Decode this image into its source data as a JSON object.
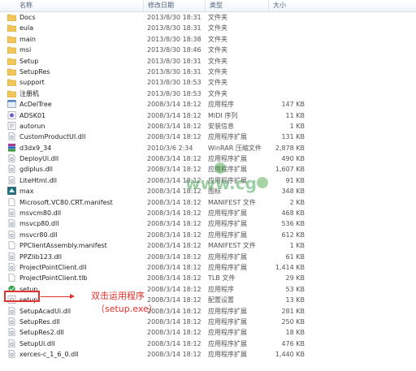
{
  "columns": {
    "name": "名称",
    "date": "修改日期",
    "type": "类型",
    "size": "大小"
  },
  "files": [
    {
      "name": "Docs",
      "date": "2013/8/30 18:31",
      "type": "文件夹",
      "size": "",
      "icon": "folder-icon"
    },
    {
      "name": "eula",
      "date": "2013/8/30 18:31",
      "type": "文件夹",
      "size": "",
      "icon": "folder-icon"
    },
    {
      "name": "main",
      "date": "2013/8/30 18:38",
      "type": "文件夹",
      "size": "",
      "icon": "folder-icon"
    },
    {
      "name": "msi",
      "date": "2013/8/30 18:46",
      "type": "文件夹",
      "size": "",
      "icon": "folder-icon"
    },
    {
      "name": "Setup",
      "date": "2013/8/30 18:31",
      "type": "文件夹",
      "size": "",
      "icon": "folder-icon"
    },
    {
      "name": "SetupRes",
      "date": "2013/8/30 18:31",
      "type": "文件夹",
      "size": "",
      "icon": "folder-icon"
    },
    {
      "name": "support",
      "date": "2013/8/30 18:53",
      "type": "文件夹",
      "size": "",
      "icon": "folder-icon"
    },
    {
      "name": "注册机",
      "date": "2013/8/30 18:53",
      "type": "文件夹",
      "size": "",
      "icon": "folder-icon"
    },
    {
      "name": "AcDelTree",
      "date": "2008/3/14 18:12",
      "type": "应用程序",
      "size": "147 KB",
      "icon": "application-icon"
    },
    {
      "name": "ADSK01",
      "date": "2008/3/14 18:12",
      "type": "MIDI 序列",
      "size": "11 KB",
      "icon": "midi-file-icon"
    },
    {
      "name": "autorun",
      "date": "2008/3/14 18:12",
      "type": "安装信息",
      "size": "1 KB",
      "icon": "setup-info-icon"
    },
    {
      "name": "CustomProductUI.dll",
      "date": "2008/3/14 18:12",
      "type": "应用程序扩展",
      "size": "131 KB",
      "icon": "dll-icon"
    },
    {
      "name": "d3dx9_34",
      "date": "2010/3/6 2:34",
      "type": "WinRAR 压缩文件",
      "size": "2,878 KB",
      "icon": "winrar-archive-icon"
    },
    {
      "name": "DeployUi.dll",
      "date": "2008/3/14 18:12",
      "type": "应用程序扩展",
      "size": "490 KB",
      "icon": "dll-icon"
    },
    {
      "name": "gdiplus.dll",
      "date": "2008/3/14 18:12",
      "type": "应用程序扩展",
      "size": "1,607 KB",
      "icon": "dll-icon"
    },
    {
      "name": "LiteHtml.dll",
      "date": "2008/3/14 18:12",
      "type": "应用程序扩展",
      "size": "91 KB",
      "icon": "dll-icon"
    },
    {
      "name": "max",
      "date": "2008/3/14 18:12",
      "type": "图标",
      "size": "348 KB",
      "icon": "max-icon"
    },
    {
      "name": "Microsoft.VC80.CRT.manifest",
      "date": "2008/3/14 18:12",
      "type": "MANIFEST 文件",
      "size": "2 KB",
      "icon": "manifest-file-icon"
    },
    {
      "name": "msvcm80.dll",
      "date": "2008/3/14 18:12",
      "type": "应用程序扩展",
      "size": "468 KB",
      "icon": "dll-icon"
    },
    {
      "name": "msvcp80.dll",
      "date": "2008/3/14 18:12",
      "type": "应用程序扩展",
      "size": "536 KB",
      "icon": "dll-icon"
    },
    {
      "name": "msvcr80.dll",
      "date": "2008/3/14 18:12",
      "type": "应用程序扩展",
      "size": "612 KB",
      "icon": "dll-icon"
    },
    {
      "name": "PPClientAssembly.manifest",
      "date": "2008/3/14 18:12",
      "type": "MANIFEST 文件",
      "size": "1 KB",
      "icon": "manifest-file-icon"
    },
    {
      "name": "PPZlib123.dll",
      "date": "2008/3/14 18:12",
      "type": "应用程序扩展",
      "size": "61 KB",
      "icon": "dll-icon"
    },
    {
      "name": "ProjectPointClient.dll",
      "date": "2008/3/14 18:12",
      "type": "应用程序扩展",
      "size": "1,414 KB",
      "icon": "dll-icon"
    },
    {
      "name": "ProjectPointClient.tlb",
      "date": "2008/3/14 18:12",
      "type": "TLB 文件",
      "size": "29 KB",
      "icon": "tlb-file-icon"
    },
    {
      "name": "setup",
      "date": "2008/3/14 18:12",
      "type": "应用程序",
      "size": "53 KB",
      "icon": "setup-exe-icon"
    },
    {
      "name": "setup",
      "date": "2008/3/14 18:12",
      "type": "配置设置",
      "size": "13 KB",
      "icon": "config-settings-icon"
    },
    {
      "name": "SetupAcadUi.dll",
      "date": "2008/3/14 18:12",
      "type": "应用程序扩展",
      "size": "281 KB",
      "icon": "dll-icon"
    },
    {
      "name": "SetupRes.dll",
      "date": "2008/3/14 18:12",
      "type": "应用程序扩展",
      "size": "250 KB",
      "icon": "dll-icon"
    },
    {
      "name": "SetupRes2.dll",
      "date": "2008/3/14 18:12",
      "type": "应用程序扩展",
      "size": "18 KB",
      "icon": "dll-icon"
    },
    {
      "name": "SetupUi.dll",
      "date": "2008/3/14 18:12",
      "type": "应用程序扩展",
      "size": "476 KB",
      "icon": "dll-icon"
    },
    {
      "name": "xerces-c_1_6_0.dll",
      "date": "2008/3/14 18:12",
      "type": "应用程序扩展",
      "size": "1,440 KB",
      "icon": "dll-icon"
    }
  ],
  "annotation": {
    "line1": "双击运用程序",
    "line2": "（setup.exe）"
  },
  "watermark": {
    "text": "www.cg"
  },
  "colors": {
    "highlight": "#e0322e",
    "folder": "#f3c65a",
    "header_text": "#4c607a"
  }
}
